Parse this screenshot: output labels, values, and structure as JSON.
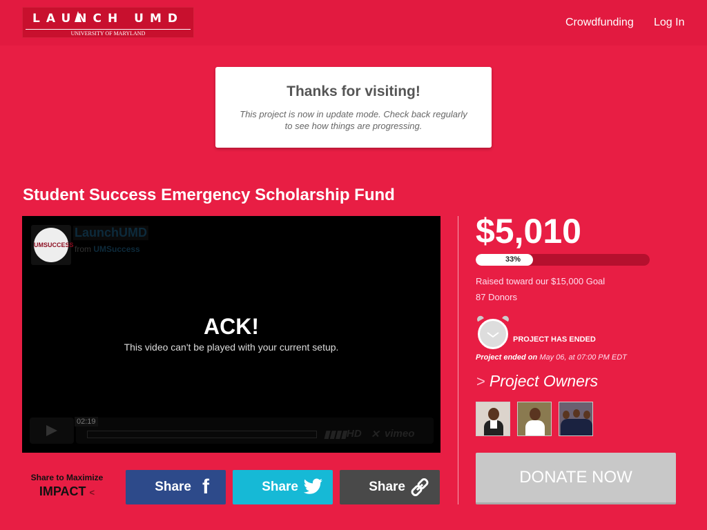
{
  "header": {
    "logo_text": "LAUNCH UMD",
    "logo_subtext": "UNIVERSITY OF MARYLAND",
    "nav": [
      {
        "label": "Crowdfunding"
      },
      {
        "label": "Log In"
      }
    ]
  },
  "notice": {
    "title": "Thanks for visiting!",
    "message": "This project is now in update mode. Check back regularly to see how things are progressing."
  },
  "project": {
    "title": "Student Success Emergency Scholarship Fund"
  },
  "video": {
    "channel_name": "LaunchUMD",
    "from_label": "from",
    "from_user": "UMSuccess",
    "avatar_text": "UMSUCCESS",
    "error_title": "ACK!",
    "error_message": "This video can't be played with your current setup.",
    "duration": "02:19",
    "hd_label": "HD",
    "brand": "vimeo"
  },
  "share": {
    "label_top": "Share to Maximize",
    "label_bottom": "IMPACT",
    "buttons": [
      {
        "label": "Share",
        "icon": "facebook-icon",
        "color": "#2d4a8a"
      },
      {
        "label": "Share",
        "icon": "twitter-icon",
        "color": "#16b9d6"
      },
      {
        "label": "Share",
        "icon": "link-icon",
        "color": "#494949"
      }
    ]
  },
  "funding": {
    "amount": "$5,010",
    "percent_label": "33%",
    "progress_fraction": 0.33,
    "raised_text": "Raised toward our $15,000 Goal",
    "donors_text": "87 Donors",
    "status": "PROJECT HAS ENDED",
    "ended_label": "Project ended on",
    "ended_date": "May 06, at 07:00 PM EDT"
  },
  "owners": {
    "heading": "Project Owners",
    "count": 3
  },
  "donate": {
    "label": "DONATE NOW"
  },
  "colors": {
    "background": "#e81e44",
    "facebook": "#2d4a8a",
    "twitter": "#16b9d6",
    "link": "#494949",
    "donate": "#c8c8c8"
  }
}
